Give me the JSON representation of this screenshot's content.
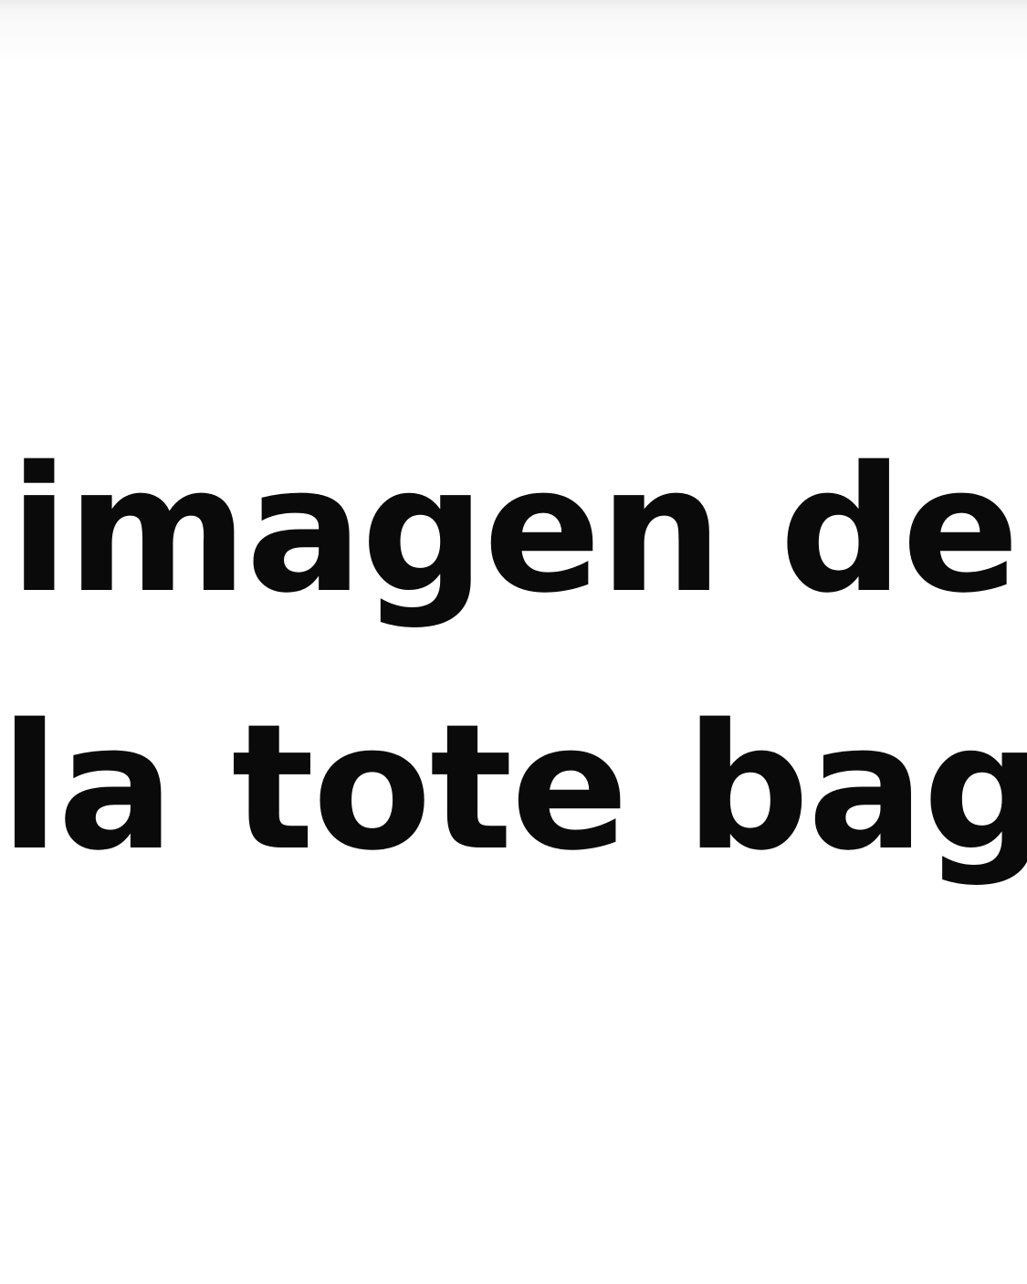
{
  "placeholder": {
    "line1": "imagen de",
    "line2": "la tote bag"
  }
}
